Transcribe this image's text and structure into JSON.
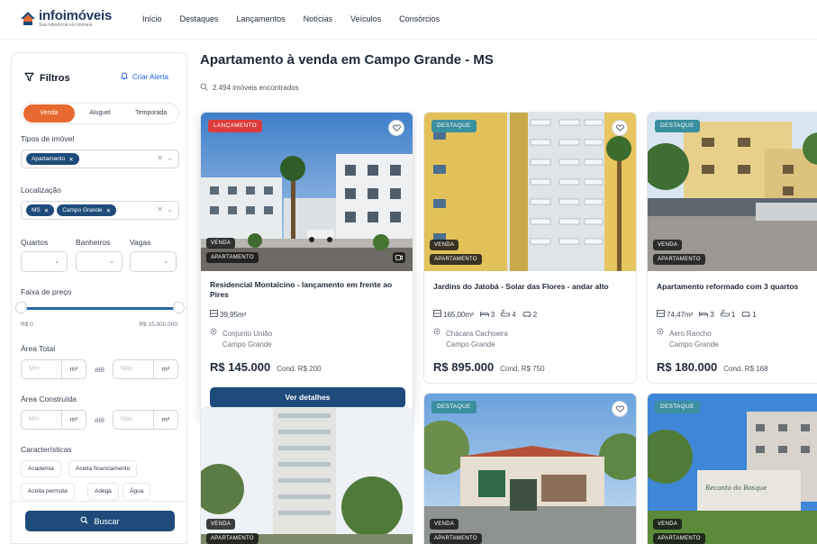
{
  "header": {
    "logo_name": "infoimóveis",
    "logo_tagline": "Sua referência em imóveis",
    "nav": [
      "Início",
      "Destaques",
      "Lançamentos",
      "Notícias",
      "Veículos",
      "Consórcios"
    ]
  },
  "sidebar": {
    "title": "Filtros",
    "create_alert": "Criar Alerta",
    "segments": [
      {
        "label": "Venda",
        "active": true
      },
      {
        "label": "Aluguel",
        "active": false
      },
      {
        "label": "Temporada",
        "active": false
      }
    ],
    "property_types_label": "Tipos de imóvel",
    "property_types_chips": [
      "Apartamento"
    ],
    "location_label": "Localização",
    "location_chips": [
      "MS",
      "Campo Grande"
    ],
    "rooms_label": "Quartos",
    "baths_label": "Banheiros",
    "parking_label": "Vagas",
    "price_label": "Faixa de preço",
    "price_min": "R$ 0",
    "price_max": "R$ 15.000.000",
    "total_area_label": "Área Total",
    "built_area_label": "Área Construída",
    "range_min_placeholder": "Mín",
    "range_max_placeholder": "Máx",
    "range_unit": "m²",
    "range_sep": "até",
    "features_label": "Características",
    "features": [
      "Academia",
      "Aceita financiamento",
      "Aceita permuta",
      "Adega",
      "Água"
    ],
    "search_button": "Buscar"
  },
  "main": {
    "title": "Apartamento à venda em Campo Grande - MS",
    "count": "2.494 imóveis encontrados",
    "details_button": "Ver detalhes",
    "cards": [
      {
        "badge": "LANÇAMENTO",
        "badge_color": "#dc3b3b",
        "business": "VENDA",
        "type": "APARTAMENTO",
        "title": "Residencial Montalcino - lançamento em frente ao Pires",
        "area": "39,95m²",
        "neighborhood": "Conjunto União",
        "city": "Campo Grande",
        "price": "R$ 145.000",
        "condo": "Cond. R$ 200"
      },
      {
        "badge": "DESTAQUE",
        "badge_color": "#3a8fa0",
        "business": "VENDA",
        "type": "APARTAMENTO",
        "title": "Jardins do Jatobá - Solar das Flores - andar alto",
        "area": "165,00m²",
        "bedrooms": "3",
        "bathrooms": "4",
        "parking": "2",
        "neighborhood": "Chácara Cachoeira",
        "city": "Campo Grande",
        "price": "R$ 895.000",
        "condo": "Cond. R$ 750"
      },
      {
        "badge": "DESTAQUE",
        "badge_color": "#3a8fa0",
        "business": "VENDA",
        "type": "APARTAMENTO",
        "title": "Apartamento reformado com 3 quartos",
        "area": "74,47m²",
        "bedrooms": "3",
        "bathrooms": "1",
        "parking": "1",
        "neighborhood": "Aero Rancho",
        "city": "Campo Grande",
        "price": "R$ 180.000",
        "condo": "Cond. R$ 168"
      },
      {
        "business": "VENDA",
        "type": "APARTAMENTO"
      },
      {
        "badge": "DESTAQUE",
        "badge_color": "#3a8fa0",
        "business": "VENDA",
        "type": "APARTAMENTO"
      },
      {
        "badge": "DESTAQUE",
        "badge_color": "#3a8fa0",
        "business": "VENDA",
        "type": "APARTAMENTO",
        "sign_text": "Recanto do Bosque"
      }
    ]
  },
  "colors": {
    "primary": "#1e4b7a",
    "accent": "#e8692f",
    "link": "#2563eb"
  }
}
